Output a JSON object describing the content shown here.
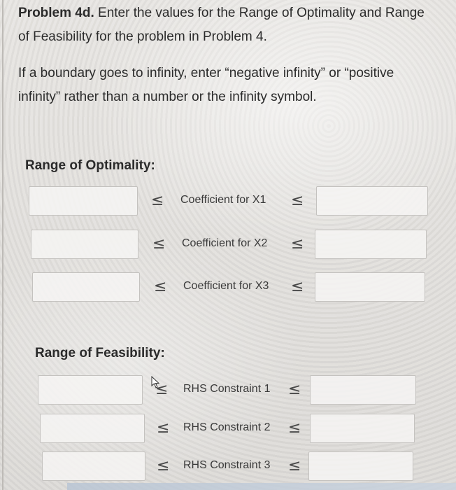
{
  "problem": {
    "title_bold": "Problem 4d.",
    "title_line1": " Enter the values for the Range of Optimality and Range",
    "title_line2": "of Feasibility for the problem in Problem 4.",
    "note_line1": "If a boundary goes to infinity, enter “negative infinity” or “positive",
    "note_line2": "infinity” rather than a number or the infinity symbol."
  },
  "symbols": {
    "le": "≤"
  },
  "optimality": {
    "title": "Range of Optimality:",
    "rows": [
      {
        "label": "Coefficient for X1",
        "lower_value": "",
        "upper_value": ""
      },
      {
        "label": "Coefficient for X2",
        "lower_value": "",
        "upper_value": ""
      },
      {
        "label": "Coefficient for X3",
        "lower_value": "",
        "upper_value": ""
      }
    ]
  },
  "feasibility": {
    "title": "Range of Feasibility:",
    "rows": [
      {
        "label": "RHS Constraint 1",
        "lower_value": "",
        "upper_value": ""
      },
      {
        "label": "RHS Constraint 2",
        "lower_value": "",
        "upper_value": ""
      },
      {
        "label": "RHS Constraint 3",
        "lower_value": "",
        "upper_value": ""
      }
    ]
  },
  "icons": {
    "pointer": "mouse-pointer-icon"
  }
}
